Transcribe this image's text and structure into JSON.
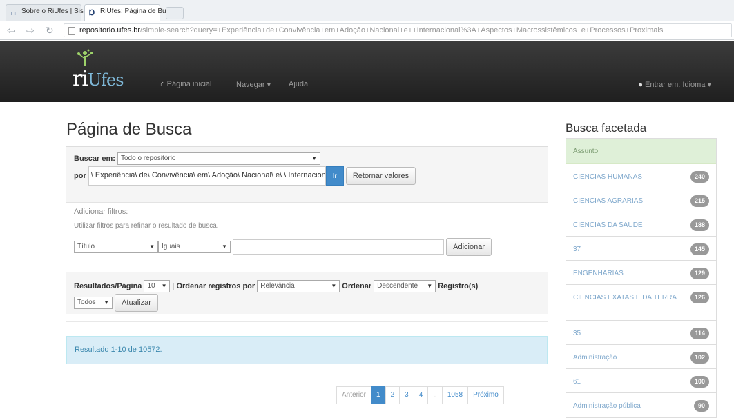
{
  "browser": {
    "tabs": [
      {
        "title": "Sobre o RiUfes | Sistema",
        "icon": "site-favicon"
      },
      {
        "title": "RiUfes: Página de Busca",
        "icon": "riufes-favicon"
      }
    ],
    "url_host": "repositorio.ufes.br",
    "url_path": "/simple-search?query=+Experiência+de+Convivência+em+Adoção+Nacional+e++Internacional%3A+Aspectos+Macrossistêmicos+e+Processos+Proximais"
  },
  "navbar": {
    "logo_ri": "ri",
    "logo_ufes": "Ufes",
    "home": "Página inicial",
    "browse": "Navegar ▾",
    "help": "Ajuda",
    "login": "Entrar em:",
    "language": "Idioma ▾"
  },
  "main": {
    "title": "Página de Busca",
    "search_in_label": "Buscar em:",
    "search_in_value": "Todo o repositório",
    "query_label": "por",
    "query_value": "\\ Experiência\\ de\\ Convivência\\ em\\ Adoção\\ Nacional\\ e\\ \\ Internacional",
    "go_button": "Ir",
    "reset_button": "Retornar valores",
    "add_filters": "Adicionar filtros:",
    "filters_hint": "Utilizar filtros para refinar o resultado de busca.",
    "filter_field": "Título",
    "filter_op": "Iguais",
    "filter_value": "",
    "add_button": "Adicionar",
    "rpp_label": "Resultados/Página",
    "rpp_value": "10",
    "sep": "|",
    "sort_label": "Ordenar registros por",
    "sort_value": "Relevância",
    "order_label": "Ordenar",
    "order_value": "Descendente",
    "records_label": "Registro(s)",
    "records_value": "Todos",
    "update_button": "Atualizar",
    "result_text": "Resultado 1-10 de 10572."
  },
  "pagination": [
    "Anterior",
    "1",
    "2",
    "3",
    "4",
    "..",
    "1058",
    "Próximo"
  ],
  "facets": {
    "title": "Busca facetada",
    "header": "Assunto",
    "items": [
      {
        "label": "CIENCIAS HUMANAS",
        "count": "240"
      },
      {
        "label": "CIENCIAS AGRARIAS",
        "count": "215"
      },
      {
        "label": "CIENCIAS DA SAUDE",
        "count": "188"
      },
      {
        "label": "37",
        "count": "145"
      },
      {
        "label": "ENGENHARIAS",
        "count": "129"
      },
      {
        "label": "CIENCIAS EXATAS E DA TERRA",
        "count": "126"
      },
      {
        "label": "35",
        "count": "114"
      },
      {
        "label": "Administração",
        "count": "102"
      },
      {
        "label": "61",
        "count": "100"
      },
      {
        "label": "Administração pública",
        "count": "90"
      }
    ]
  }
}
